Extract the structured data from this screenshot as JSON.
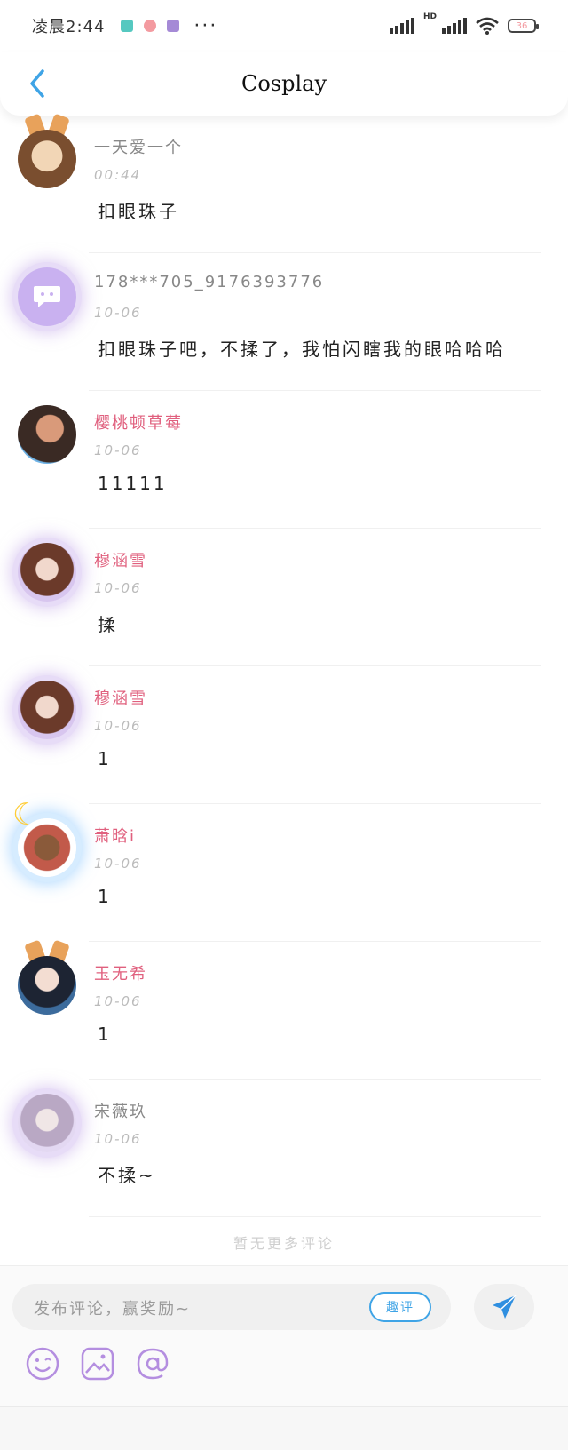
{
  "status_bar": {
    "time": "凌晨2:44",
    "more": "···",
    "hd": "HD",
    "battery": "36"
  },
  "header": {
    "back_icon": "chevron-left-icon",
    "title": "Cosplay"
  },
  "comments": [
    {
      "name": "一天爱一个",
      "date": "00:44",
      "text": "扣眼珠子",
      "name_color": "#888888"
    },
    {
      "name": "178***705_9176393776",
      "date": "10-06",
      "text": "扣眼珠子吧，不揉了，我怕闪瞎我的眼哈哈哈",
      "name_color": "#888888"
    },
    {
      "name": "樱桃顿草莓",
      "date": "10-06",
      "text": "11111",
      "name_color": "#e0607e"
    },
    {
      "name": "穆涵雪",
      "date": "10-06",
      "text": "揉",
      "name_color": "#e0607e"
    },
    {
      "name": "穆涵雪",
      "date": "10-06",
      "text": "1",
      "name_color": "#e0607e"
    },
    {
      "name": "萧晗i",
      "date": "10-06",
      "text": "1",
      "name_color": "#e0607e"
    },
    {
      "name": "玉无希",
      "date": "10-06",
      "text": "1",
      "name_color": "#e0607e"
    },
    {
      "name": "宋薇玖",
      "date": "10-06",
      "text": "不揉~",
      "name_color": "#888888"
    }
  ],
  "no_more_text": "暂无更多评论",
  "composer": {
    "placeholder": "发布评论，赢奖励~",
    "quping_label": "趣评",
    "send_icon": "send-icon",
    "tools": [
      "emoji-icon",
      "image-icon",
      "at-icon"
    ]
  },
  "colors": {
    "accent": "#3fa4e6",
    "pink_name": "#e0607e",
    "tool_purple": "#b48ee0"
  }
}
